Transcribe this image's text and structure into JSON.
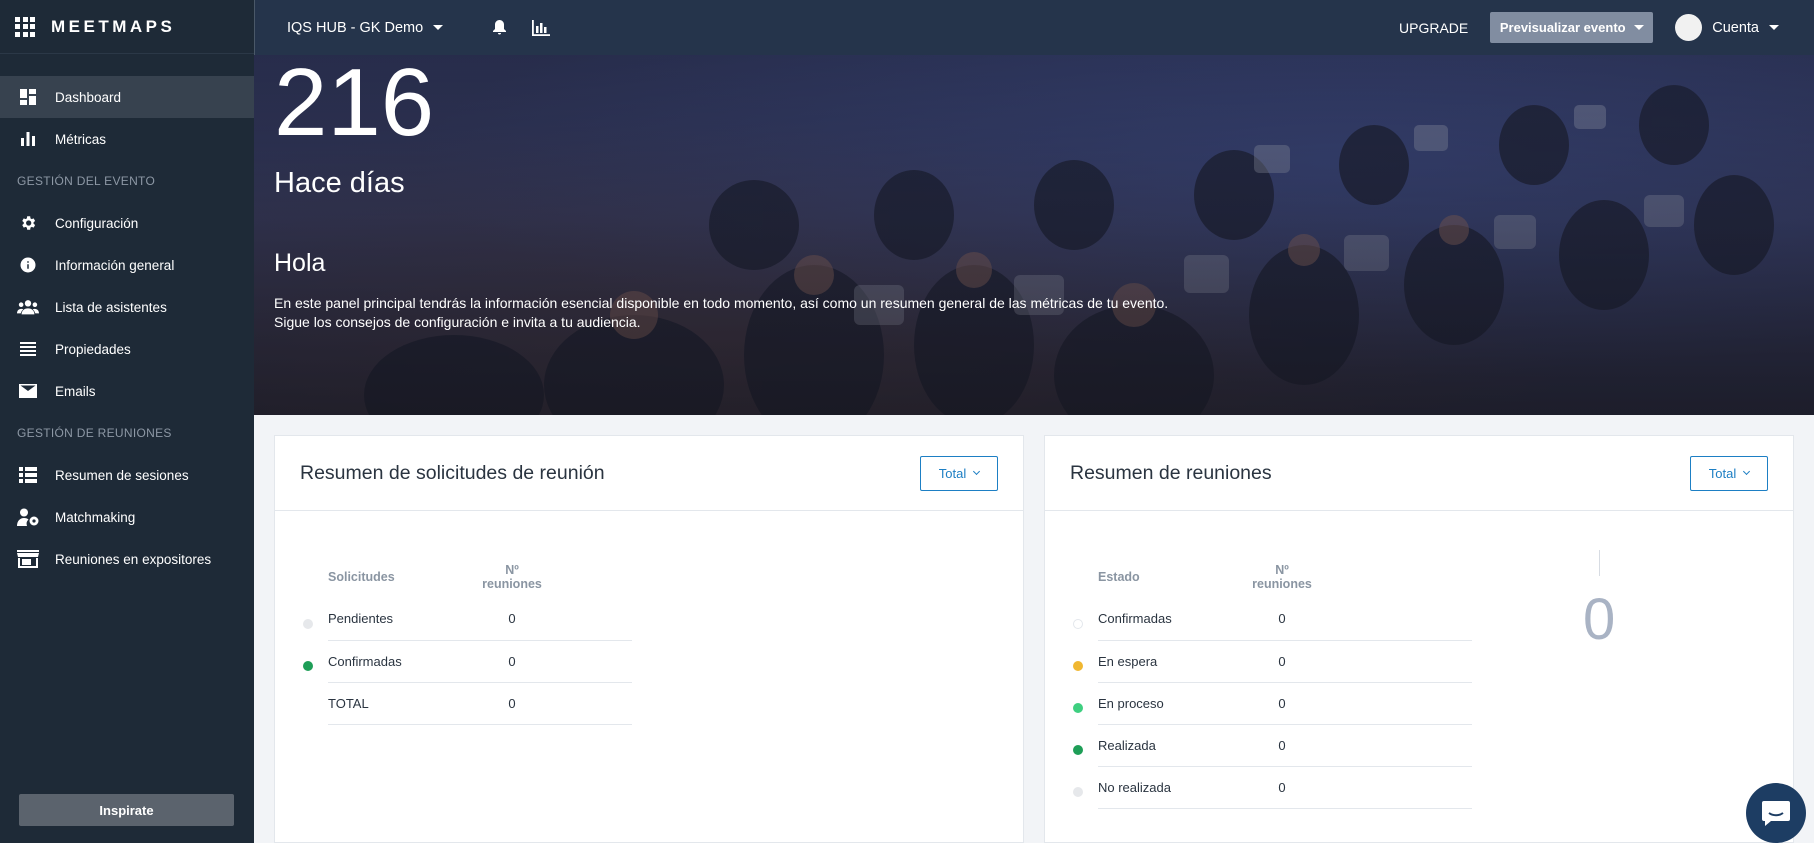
{
  "app": {
    "brand": "MEETMAPS"
  },
  "sidebar": {
    "items": [
      {
        "label": "Dashboard",
        "icon": "dashboard-icon"
      },
      {
        "label": "Métricas",
        "icon": "bar-chart-icon"
      }
    ],
    "section_event": "GESTIÓN DEL EVENTO",
    "event_items": [
      {
        "label": "Configuración",
        "icon": "gear-icon"
      },
      {
        "label": "Información general",
        "icon": "info-icon"
      },
      {
        "label": "Lista de asistentes",
        "icon": "people-icon"
      },
      {
        "label": "Propiedades",
        "icon": "list-icon"
      },
      {
        "label": "Emails",
        "icon": "envelope-icon"
      }
    ],
    "section_meetings": "GESTIÓN DE REUNIONES",
    "meeting_items": [
      {
        "label": "Resumen de sesiones",
        "icon": "table-list-icon"
      },
      {
        "label": "Matchmaking",
        "icon": "user-gear-icon"
      },
      {
        "label": "Reuniones en expositores",
        "icon": "store-icon"
      }
    ],
    "inspirate_label": "Inspirate"
  },
  "topbar": {
    "event_name": "IQS HUB - GK Demo",
    "upgrade_label": "UPGRADE",
    "preview_label": "Previsualizar evento",
    "account_label": "Cuenta"
  },
  "hero": {
    "number": "216",
    "days_label": "Hace días",
    "greeting": "Hola",
    "text_line1": "En este panel principal tendrás la información esencial disponible en todo momento, así como un resumen general de las métricas de tu evento.",
    "text_line2": "Sigue los consejos de configuración e invita a tu audiencia."
  },
  "requests_card": {
    "title": "Resumen de solicitudes de reunión",
    "filter_label": "Total",
    "col1": "Solicitudes",
    "col2_line1": "Nº",
    "col2_line2": "reuniones",
    "rows": [
      {
        "label": "Pendientes",
        "value": "0",
        "color": "#e6e8eb"
      },
      {
        "label": "Confirmadas",
        "value": "0",
        "color": "#1e9e57"
      },
      {
        "label": "TOTAL",
        "value": "0",
        "color": ""
      }
    ]
  },
  "meetings_card": {
    "title": "Resumen de reuniones",
    "filter_label": "Total",
    "col1": "Estado",
    "col2_line1": "Nº",
    "col2_line2": "reuniones",
    "rows": [
      {
        "label": "Confirmadas",
        "value": "0",
        "color": "#ffffff"
      },
      {
        "label": "En espera",
        "value": "0",
        "color": "#f0b731"
      },
      {
        "label": "En proceso",
        "value": "0",
        "color": "#3ecf80"
      },
      {
        "label": "Realizada",
        "value": "0",
        "color": "#1e9e57"
      },
      {
        "label": "No realizada",
        "value": "0",
        "color": "#e6e8eb"
      }
    ],
    "big_value": "0"
  },
  "colors": {
    "sidebar_bg": "#1e2a37",
    "topbar_bg": "#25344b",
    "accent": "#1d7fc4"
  }
}
